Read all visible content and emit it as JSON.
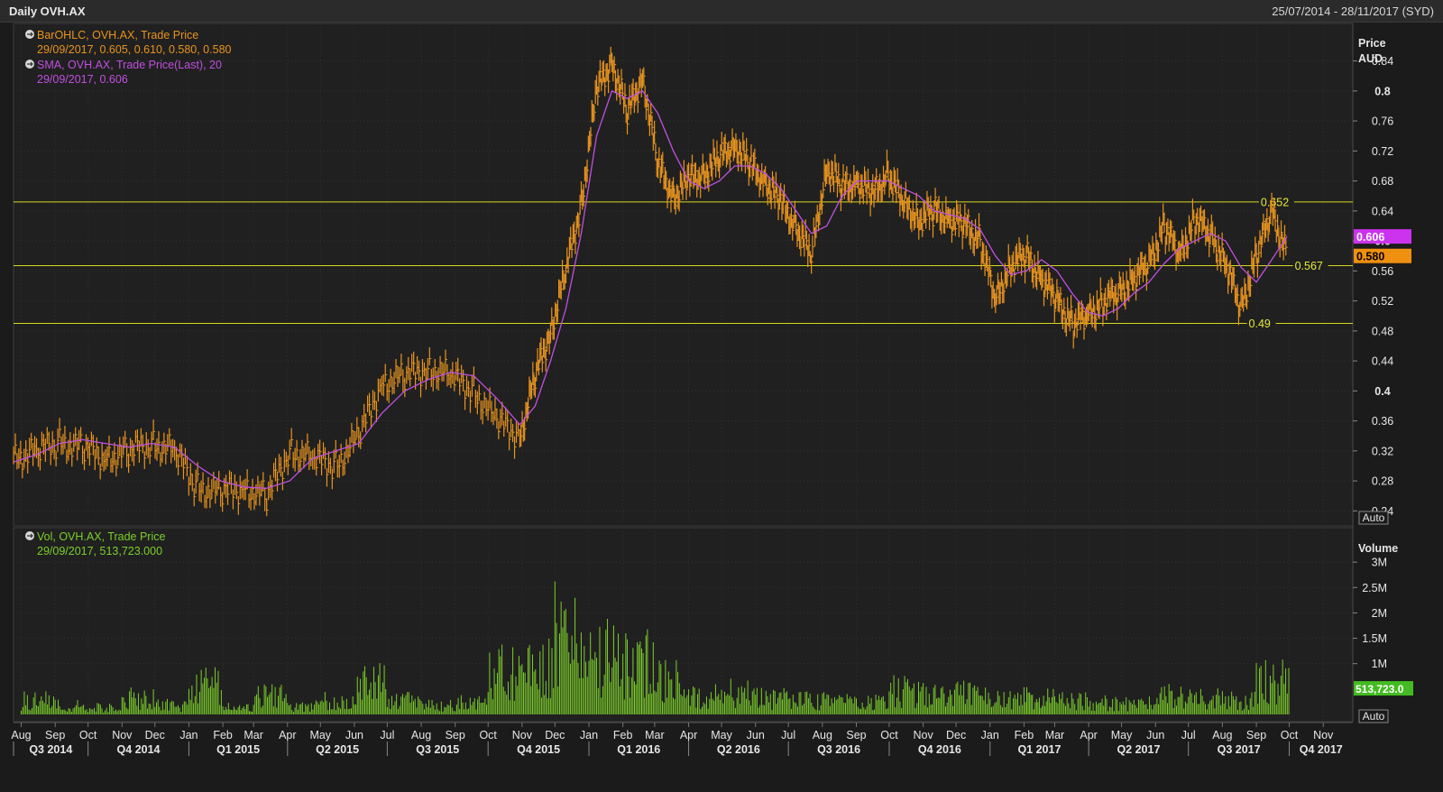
{
  "header": {
    "title": "Daily OVH.AX",
    "date_range": "25/07/2014 - 28/11/2017 (SYD)"
  },
  "price_panel": {
    "legend": [
      {
        "icon": "circle-arrow-icon",
        "label": "BarOHLC, OVH.AX, Trade Price",
        "values": "29/09/2017, 0.605, 0.610, 0.580, 0.580",
        "color": "#e8941e"
      },
      {
        "icon": "circle-arrow-icon",
        "label": "SMA, OVH.AX, Trade Price(Last),  20",
        "values": "29/09/2017, 0.606",
        "color": "#c050e0"
      }
    ],
    "axis_title": "Price",
    "axis_unit": "AUD",
    "auto_label": "Auto",
    "ticks": [
      {
        "v": 0.84,
        "label": "0.84",
        "bold": false
      },
      {
        "v": 0.8,
        "label": "0.8",
        "bold": true
      },
      {
        "v": 0.76,
        "label": "0.76",
        "bold": false
      },
      {
        "v": 0.72,
        "label": "0.72",
        "bold": false
      },
      {
        "v": 0.68,
        "label": "0.68",
        "bold": false
      },
      {
        "v": 0.64,
        "label": "0.64",
        "bold": false
      },
      {
        "v": 0.6,
        "label": "0.6",
        "bold": true
      },
      {
        "v": 0.56,
        "label": "0.56",
        "bold": false
      },
      {
        "v": 0.52,
        "label": "0.52",
        "bold": false
      },
      {
        "v": 0.48,
        "label": "0.48",
        "bold": false
      },
      {
        "v": 0.44,
        "label": "0.44",
        "bold": false
      },
      {
        "v": 0.4,
        "label": "0.4",
        "bold": true
      },
      {
        "v": 0.36,
        "label": "0.36",
        "bold": false
      },
      {
        "v": 0.32,
        "label": "0.32",
        "bold": false
      },
      {
        "v": 0.28,
        "label": "0.28",
        "bold": false
      },
      {
        "v": 0.24,
        "label": "0.24",
        "bold": false
      }
    ],
    "hlines": [
      {
        "v": 0.652,
        "label": "0.652",
        "label_date": "2017-09-05"
      },
      {
        "v": 0.567,
        "label": "0.567",
        "label_date": "2017-10-06"
      },
      {
        "v": 0.49,
        "label": "0.49",
        "label_date": "2017-08-25"
      }
    ],
    "last_badges": [
      {
        "v": 0.606,
        "label": "0.606",
        "color": "#cc33ee"
      },
      {
        "v": 0.58,
        "label": "0.580",
        "color": "#f09010"
      }
    ]
  },
  "volume_panel": {
    "legend": [
      {
        "icon": "circle-arrow-icon",
        "label": "Vol, OVH.AX, Trade Price",
        "values": "29/09/2017, 513,723.000",
        "color": "#7ccf2a"
      }
    ],
    "axis_title": "Volume",
    "auto_label": "Auto",
    "ticks": [
      {
        "v": 3000000,
        "label": "3M"
      },
      {
        "v": 2500000,
        "label": "2.5M"
      },
      {
        "v": 2000000,
        "label": "2M"
      },
      {
        "v": 1500000,
        "label": "1.5M"
      },
      {
        "v": 1000000,
        "label": "1M"
      }
    ],
    "last_badge": {
      "v": 513723,
      "label": "513,723.0",
      "color": "#44bb22"
    }
  },
  "x_axis": {
    "months": [
      {
        "label": "Aug",
        "date": "2014-08-01"
      },
      {
        "label": "Sep",
        "date": "2014-09-01"
      },
      {
        "label": "Oct",
        "date": "2014-10-01"
      },
      {
        "label": "Nov",
        "date": "2014-11-01"
      },
      {
        "label": "Dec",
        "date": "2014-12-01"
      },
      {
        "label": "Jan",
        "date": "2015-01-01"
      },
      {
        "label": "Feb",
        "date": "2015-02-01"
      },
      {
        "label": "Mar",
        "date": "2015-03-01"
      },
      {
        "label": "Apr",
        "date": "2015-04-01"
      },
      {
        "label": "May",
        "date": "2015-05-01"
      },
      {
        "label": "Jun",
        "date": "2015-06-01"
      },
      {
        "label": "Jul",
        "date": "2015-07-01"
      },
      {
        "label": "Aug",
        "date": "2015-08-01"
      },
      {
        "label": "Sep",
        "date": "2015-09-01"
      },
      {
        "label": "Oct",
        "date": "2015-10-01"
      },
      {
        "label": "Nov",
        "date": "2015-11-01"
      },
      {
        "label": "Dec",
        "date": "2015-12-01"
      },
      {
        "label": "Jan",
        "date": "2016-01-01"
      },
      {
        "label": "Feb",
        "date": "2016-02-01"
      },
      {
        "label": "Mar",
        "date": "2016-03-01"
      },
      {
        "label": "Apr",
        "date": "2016-04-01"
      },
      {
        "label": "May",
        "date": "2016-05-01"
      },
      {
        "label": "Jun",
        "date": "2016-06-01"
      },
      {
        "label": "Jul",
        "date": "2016-07-01"
      },
      {
        "label": "Aug",
        "date": "2016-08-01"
      },
      {
        "label": "Sep",
        "date": "2016-09-01"
      },
      {
        "label": "Oct",
        "date": "2016-10-01"
      },
      {
        "label": "Nov",
        "date": "2016-11-01"
      },
      {
        "label": "Dec",
        "date": "2016-12-01"
      },
      {
        "label": "Jan",
        "date": "2017-01-01"
      },
      {
        "label": "Feb",
        "date": "2017-02-01"
      },
      {
        "label": "Mar",
        "date": "2017-03-01"
      },
      {
        "label": "Apr",
        "date": "2017-04-01"
      },
      {
        "label": "May",
        "date": "2017-05-01"
      },
      {
        "label": "Jun",
        "date": "2017-06-01"
      },
      {
        "label": "Jul",
        "date": "2017-07-01"
      },
      {
        "label": "Aug",
        "date": "2017-08-01"
      },
      {
        "label": "Sep",
        "date": "2017-09-01"
      },
      {
        "label": "Oct",
        "date": "2017-10-01"
      },
      {
        "label": "Nov",
        "date": "2017-11-01"
      }
    ],
    "quarters": [
      {
        "label": "Q3 2014",
        "start": "2014-07-25",
        "end": "2014-10-01"
      },
      {
        "label": "Q4 2014",
        "start": "2014-10-01",
        "end": "2015-01-01"
      },
      {
        "label": "Q1 2015",
        "start": "2015-01-01",
        "end": "2015-04-01"
      },
      {
        "label": "Q2 2015",
        "start": "2015-04-01",
        "end": "2015-07-01"
      },
      {
        "label": "Q3 2015",
        "start": "2015-07-01",
        "end": "2015-10-01"
      },
      {
        "label": "Q4 2015",
        "start": "2015-10-01",
        "end": "2016-01-01"
      },
      {
        "label": "Q1 2016",
        "start": "2016-01-01",
        "end": "2016-04-01"
      },
      {
        "label": "Q2 2016",
        "start": "2016-04-01",
        "end": "2016-07-01"
      },
      {
        "label": "Q3 2016",
        "start": "2016-07-01",
        "end": "2016-10-01"
      },
      {
        "label": "Q4 2016",
        "start": "2016-10-01",
        "end": "2017-01-01"
      },
      {
        "label": "Q1 2017",
        "start": "2017-01-01",
        "end": "2017-04-01"
      },
      {
        "label": "Q2 2017",
        "start": "2017-04-01",
        "end": "2017-07-01"
      },
      {
        "label": "Q3 2017",
        "start": "2017-07-01",
        "end": "2017-10-01"
      },
      {
        "label": "Q4 2017",
        "start": "2017-10-01",
        "end": "2017-11-28"
      }
    ]
  },
  "chart_data": {
    "type": "line",
    "x_range": [
      "2014-07-25",
      "2017-11-28"
    ],
    "price_ylim": [
      0.22,
      0.89
    ],
    "volume_ylim": [
      0,
      3500000
    ],
    "grid": true,
    "series": [
      {
        "name": "BarOHLC, OVH.AX, Trade Price",
        "color": "#e8941e",
        "x": [
          "2014-07-25",
          "2014-08-15",
          "2014-09-05",
          "2014-09-26",
          "2014-10-17",
          "2014-11-07",
          "2014-11-28",
          "2014-12-19",
          "2015-01-09",
          "2015-01-30",
          "2015-02-20",
          "2015-03-13",
          "2015-04-03",
          "2015-04-24",
          "2015-05-15",
          "2015-06-05",
          "2015-06-26",
          "2015-07-17",
          "2015-08-07",
          "2015-08-28",
          "2015-09-18",
          "2015-10-09",
          "2015-10-30",
          "2015-11-13",
          "2015-11-27",
          "2015-12-11",
          "2015-12-25",
          "2016-01-08",
          "2016-01-22",
          "2016-02-05",
          "2016-02-19",
          "2016-03-04",
          "2016-03-18",
          "2016-04-01",
          "2016-04-15",
          "2016-04-29",
          "2016-05-13",
          "2016-05-27",
          "2016-06-10",
          "2016-06-24",
          "2016-07-08",
          "2016-07-22",
          "2016-08-05",
          "2016-08-19",
          "2016-09-02",
          "2016-09-16",
          "2016-09-30",
          "2016-10-14",
          "2016-10-28",
          "2016-11-11",
          "2016-11-25",
          "2016-12-09",
          "2016-12-23",
          "2017-01-06",
          "2017-01-20",
          "2017-02-03",
          "2017-02-17",
          "2017-03-03",
          "2017-03-17",
          "2017-03-31",
          "2017-04-14",
          "2017-04-28",
          "2017-05-12",
          "2017-05-26",
          "2017-06-09",
          "2017-06-23",
          "2017-07-07",
          "2017-07-21",
          "2017-08-04",
          "2017-08-18",
          "2017-09-01",
          "2017-09-15",
          "2017-09-29"
        ],
        "values": [
          0.31,
          0.32,
          0.33,
          0.325,
          0.31,
          0.32,
          0.33,
          0.32,
          0.27,
          0.265,
          0.27,
          0.26,
          0.32,
          0.31,
          0.3,
          0.34,
          0.41,
          0.42,
          0.43,
          0.42,
          0.4,
          0.36,
          0.34,
          0.42,
          0.48,
          0.56,
          0.65,
          0.8,
          0.84,
          0.77,
          0.82,
          0.7,
          0.66,
          0.68,
          0.69,
          0.71,
          0.73,
          0.7,
          0.68,
          0.65,
          0.62,
          0.58,
          0.7,
          0.67,
          0.68,
          0.66,
          0.69,
          0.65,
          0.63,
          0.64,
          0.63,
          0.62,
          0.6,
          0.52,
          0.57,
          0.58,
          0.55,
          0.52,
          0.49,
          0.5,
          0.52,
          0.53,
          0.55,
          0.57,
          0.62,
          0.58,
          0.63,
          0.61,
          0.57,
          0.51,
          0.58,
          0.64,
          0.58
        ]
      },
      {
        "name": "SMA, OVH.AX, Trade Price(Last),  20",
        "color": "#c050e0",
        "x": [
          "2014-07-25",
          "2014-08-15",
          "2014-09-05",
          "2014-09-26",
          "2014-10-17",
          "2014-11-07",
          "2014-11-28",
          "2014-12-19",
          "2015-01-09",
          "2015-01-30",
          "2015-02-20",
          "2015-03-13",
          "2015-04-03",
          "2015-04-24",
          "2015-05-15",
          "2015-06-05",
          "2015-06-26",
          "2015-07-17",
          "2015-08-07",
          "2015-08-28",
          "2015-09-18",
          "2015-10-09",
          "2015-10-30",
          "2015-11-13",
          "2015-11-27",
          "2015-12-11",
          "2015-12-25",
          "2016-01-08",
          "2016-01-22",
          "2016-02-05",
          "2016-02-19",
          "2016-03-04",
          "2016-03-18",
          "2016-04-01",
          "2016-04-15",
          "2016-04-29",
          "2016-05-13",
          "2016-05-27",
          "2016-06-10",
          "2016-06-24",
          "2016-07-08",
          "2016-07-22",
          "2016-08-05",
          "2016-08-19",
          "2016-09-02",
          "2016-09-16",
          "2016-09-30",
          "2016-10-14",
          "2016-10-28",
          "2016-11-11",
          "2016-11-25",
          "2016-12-09",
          "2016-12-23",
          "2017-01-06",
          "2017-01-20",
          "2017-02-03",
          "2017-02-17",
          "2017-03-03",
          "2017-03-17",
          "2017-03-31",
          "2017-04-14",
          "2017-04-28",
          "2017-05-12",
          "2017-05-26",
          "2017-06-09",
          "2017-06-23",
          "2017-07-07",
          "2017-07-21",
          "2017-08-04",
          "2017-08-18",
          "2017-09-01",
          "2017-09-15",
          "2017-09-29"
        ],
        "values": [
          0.305,
          0.315,
          0.33,
          0.335,
          0.33,
          0.325,
          0.33,
          0.325,
          0.3,
          0.28,
          0.272,
          0.27,
          0.28,
          0.31,
          0.32,
          0.33,
          0.37,
          0.4,
          0.415,
          0.425,
          0.42,
          0.39,
          0.355,
          0.38,
          0.44,
          0.51,
          0.61,
          0.74,
          0.8,
          0.79,
          0.8,
          0.77,
          0.72,
          0.68,
          0.67,
          0.68,
          0.7,
          0.7,
          0.69,
          0.67,
          0.64,
          0.61,
          0.62,
          0.66,
          0.68,
          0.68,
          0.68,
          0.67,
          0.66,
          0.64,
          0.635,
          0.63,
          0.615,
          0.58,
          0.555,
          0.56,
          0.575,
          0.56,
          0.53,
          0.505,
          0.5,
          0.51,
          0.53,
          0.545,
          0.57,
          0.59,
          0.6,
          0.61,
          0.6,
          0.565,
          0.545,
          0.575,
          0.606
        ]
      },
      {
        "name": "Vol, OVH.AX, Trade Price",
        "color": "#7ccf2a",
        "x": [
          "2014-08-01",
          "2014-09-01",
          "2014-10-01",
          "2014-11-01",
          "2014-12-01",
          "2015-01-01",
          "2015-02-01",
          "2015-03-01",
          "2015-04-01",
          "2015-05-01",
          "2015-06-01",
          "2015-07-01",
          "2015-08-01",
          "2015-09-01",
          "2015-10-01",
          "2015-11-01",
          "2015-12-01",
          "2016-01-01",
          "2016-02-01",
          "2016-03-01",
          "2016-04-01",
          "2016-05-01",
          "2016-06-01",
          "2016-07-01",
          "2016-08-01",
          "2016-09-01",
          "2016-10-01",
          "2016-11-01",
          "2016-12-01",
          "2017-01-01",
          "2017-02-01",
          "2017-03-01",
          "2017-04-01",
          "2017-05-01",
          "2017-06-01",
          "2017-07-01",
          "2017-08-01",
          "2017-09-01"
        ],
        "values": [
          300000,
          200000,
          150000,
          350000,
          200000,
          600000,
          150000,
          400000,
          200000,
          300000,
          700000,
          300000,
          200000,
          250000,
          900000,
          1200000,
          1800000,
          1300000,
          1100000,
          700000,
          400000,
          500000,
          350000,
          300000,
          300000,
          280000,
          500000,
          400000,
          450000,
          300000,
          350000,
          300000,
          250000,
          250000,
          400000,
          350000,
          300000,
          700000
        ]
      }
    ]
  }
}
